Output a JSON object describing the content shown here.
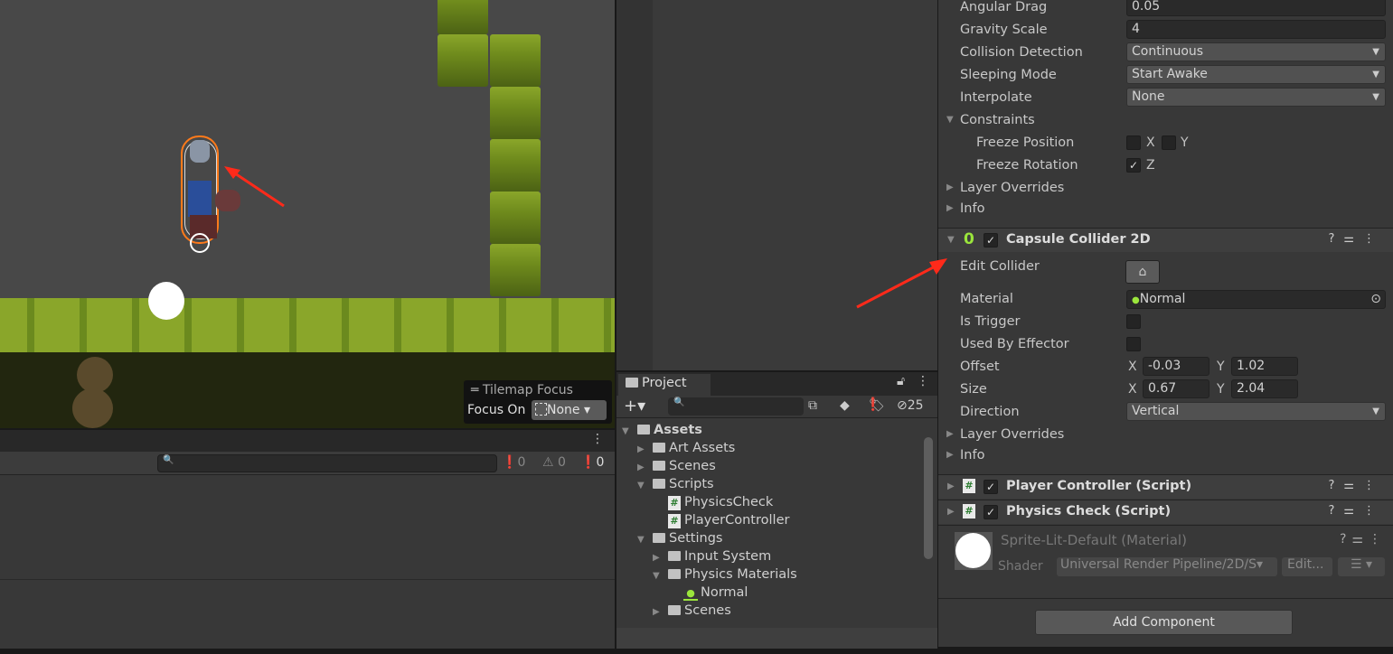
{
  "scene": {
    "tilemap_focus": {
      "title": "Tilemap Focus",
      "focus_on_label": "Focus On",
      "focus_value": "None"
    }
  },
  "console": {
    "counts": {
      "info": "0",
      "warning": "0",
      "error": "0"
    }
  },
  "project": {
    "tab": "Project",
    "hidden_count": "25",
    "tree": [
      {
        "label": "Assets",
        "level": 0,
        "type": "folder-open",
        "bold": true
      },
      {
        "label": "Art Assets",
        "level": 1,
        "type": "folder"
      },
      {
        "label": "Scenes",
        "level": 1,
        "type": "folder"
      },
      {
        "label": "Scripts",
        "level": 1,
        "type": "folder-open"
      },
      {
        "label": "PhysicsCheck",
        "level": 2,
        "type": "script"
      },
      {
        "label": "PlayerController",
        "level": 2,
        "type": "script"
      },
      {
        "label": "Settings",
        "level": 1,
        "type": "folder-open"
      },
      {
        "label": "Input System",
        "level": 2,
        "type": "folder"
      },
      {
        "label": "Physics Materials",
        "level": 2,
        "type": "folder-open"
      },
      {
        "label": "Normal",
        "level": 3,
        "type": "physics-material"
      },
      {
        "label": "Scenes",
        "level": 2,
        "type": "folder"
      }
    ]
  },
  "inspector": {
    "rigidbody": {
      "angular_drag": {
        "label": "Angular Drag",
        "value": "0.05"
      },
      "gravity_scale": {
        "label": "Gravity Scale",
        "value": "4"
      },
      "collision_detection": {
        "label": "Collision Detection",
        "value": "Continuous"
      },
      "sleeping_mode": {
        "label": "Sleeping Mode",
        "value": "Start Awake"
      },
      "interpolate": {
        "label": "Interpolate",
        "value": "None"
      },
      "constraints": "Constraints",
      "freeze_position": {
        "label": "Freeze Position",
        "x": "X",
        "y": "Y",
        "x_checked": false,
        "y_checked": false
      },
      "freeze_rotation": {
        "label": "Freeze Rotation",
        "z": "Z",
        "z_checked": true
      },
      "layer_overrides": "Layer Overrides",
      "info": "Info"
    },
    "capsule": {
      "title": "Capsule Collider 2D",
      "edit_collider": "Edit Collider",
      "material": {
        "label": "Material",
        "value": "Normal"
      },
      "is_trigger": {
        "label": "Is Trigger",
        "checked": false
      },
      "used_by_effector": {
        "label": "Used By Effector",
        "checked": false
      },
      "offset": {
        "label": "Offset",
        "x": "-0.03",
        "y": "1.02"
      },
      "size": {
        "label": "Size",
        "x": "0.67",
        "y": "2.04"
      },
      "direction": {
        "label": "Direction",
        "value": "Vertical"
      },
      "layer_overrides": "Layer Overrides",
      "info": "Info",
      "xl": "X",
      "yl": "Y"
    },
    "player_controller": "Player Controller (Script)",
    "physics_check": "Physics Check (Script)",
    "material": {
      "title": "Sprite-Lit-Default (Material)",
      "shader_label": "Shader",
      "shader_value": "Universal Render Pipeline/2D/S",
      "edit": "Edit..."
    },
    "add_component": "Add Component"
  },
  "colors": {
    "annotation_arrow": "#ff2a1a",
    "collider_green": "#9be63c",
    "selection_orange": "#ff7a1a"
  }
}
